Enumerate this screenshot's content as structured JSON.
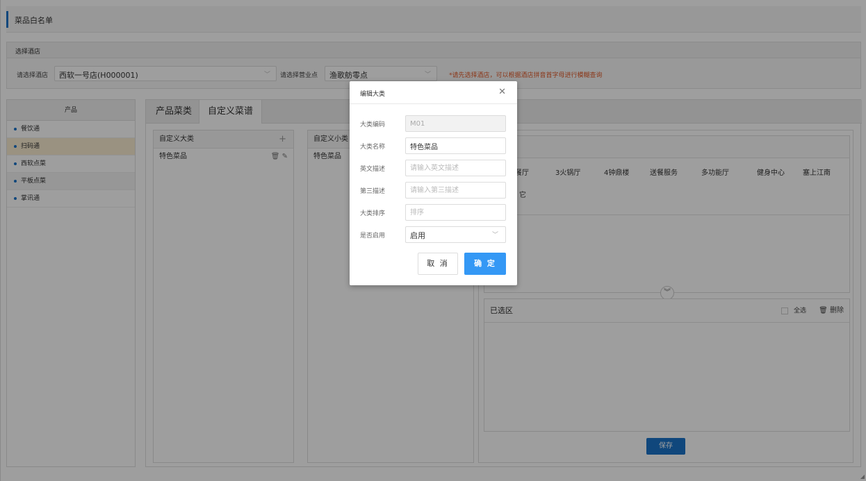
{
  "page_title": "菜品白名单",
  "select_hotel_section": "选择酒店",
  "filters": {
    "hotel_label": "请选择酒店",
    "hotel_value": "西软一号店(H000001)",
    "outlet_label": "请选择营业点",
    "outlet_value": "渔歌舫零点",
    "hint": "*请先选择酒店，可以根据酒店拼音首字母进行模糊查询"
  },
  "products": {
    "header": "产品",
    "items": [
      "餐饮通",
      "扫码通",
      "西软点菜",
      "平板点菜",
      "掌讯通"
    ]
  },
  "tabs": [
    "产品菜类",
    "自定义菜谱"
  ],
  "major_category": {
    "header": "自定义大类",
    "add_icon": "+",
    "rows": [
      "特色菜品"
    ]
  },
  "minor_category": {
    "header": "自定义小类",
    "rows": [
      "特色菜品"
    ]
  },
  "outlets": [
    "餐厅",
    "3火锅厅",
    "4钟鼎楼",
    "送餐服务",
    "多功能厅",
    "健身中心",
    "塞上江南",
    "它"
  ],
  "selected_area": {
    "title": "已选区",
    "select_all": "全选",
    "delete": "删除"
  },
  "save_label": "保存",
  "modal": {
    "title": "编辑大类",
    "fields": {
      "code_label": "大类编码",
      "code_value": "M01",
      "name_label": "大类名称",
      "name_value": "特色菜品",
      "en_label": "英文描述",
      "en_placeholder": "请输入英文描述",
      "third_label": "第三描述",
      "third_placeholder": "请输入第三描述",
      "sort_label": "大类排序",
      "sort_placeholder": "排序",
      "enabled_label": "是否启用",
      "enabled_value": "启用"
    },
    "cancel": "取 消",
    "ok": "确 定"
  },
  "colors": {
    "accent": "#1a73c9",
    "primary_button": "#3498f5",
    "hint": "#e05a29",
    "active_row": "#f9ecd1"
  }
}
